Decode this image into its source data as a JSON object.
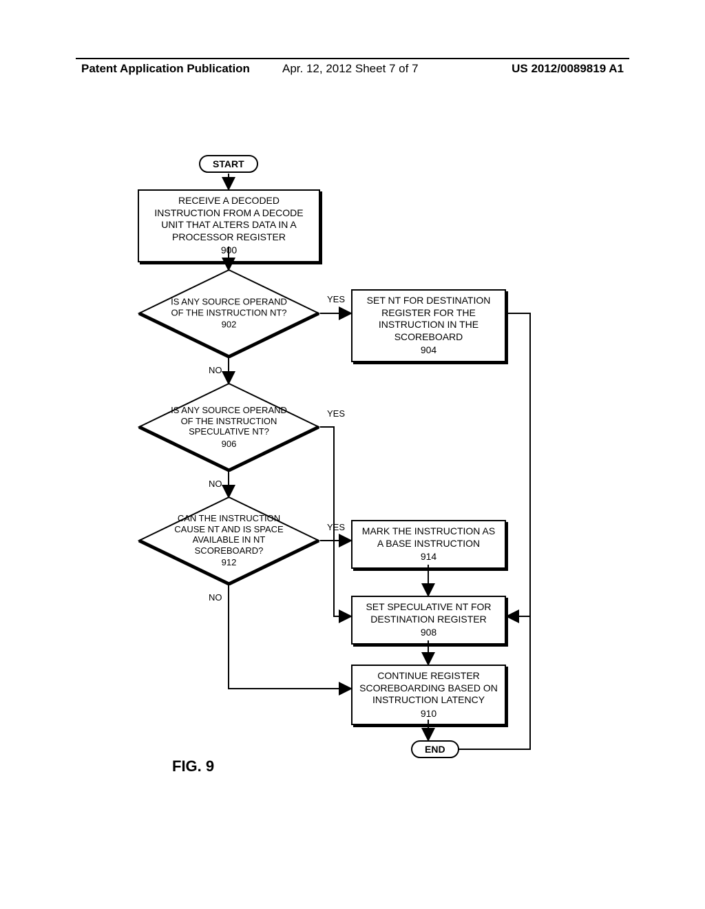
{
  "header": {
    "left": "Patent Application Publication",
    "center": "Apr. 12, 2012  Sheet 7 of 7",
    "right": "US 2012/0089819 A1"
  },
  "figure_label": "FIG. 9",
  "terminators": {
    "start": "START",
    "end": "END"
  },
  "blocks": {
    "b900": {
      "text": "RECEIVE A DECODED INSTRUCTION FROM A DECODE UNIT THAT ALTERS DATA IN A PROCESSOR REGISTER",
      "ref": "900"
    },
    "b904": {
      "text": "SET NT FOR DESTINATION REGISTER FOR THE INSTRUCTION IN THE SCOREBOARD",
      "ref": "904"
    },
    "b914": {
      "text": "MARK THE INSTRUCTION AS A BASE INSTRUCTION",
      "ref": "914"
    },
    "b908": {
      "text": "SET SPECULATIVE NT FOR DESTINATION REGISTER",
      "ref": "908"
    },
    "b910": {
      "text": "CONTINUE REGISTER SCOREBOARDING BASED ON INSTRUCTION LATENCY",
      "ref": "910"
    }
  },
  "decisions": {
    "d902": {
      "text": "IS ANY SOURCE OPERAND OF THE INSTRUCTION NT?",
      "ref": "902"
    },
    "d906": {
      "text": "IS ANY SOURCE OPERAND OF THE INSTRUCTION SPECULATIVE NT?",
      "ref": "906"
    },
    "d912": {
      "text": "CAN THE INSTRUCTION CAUSE NT AND IS SPACE AVAILABLE IN NT SCOREBOARD?",
      "ref": "912"
    }
  },
  "labels": {
    "yes": "YES",
    "no": "NO"
  }
}
